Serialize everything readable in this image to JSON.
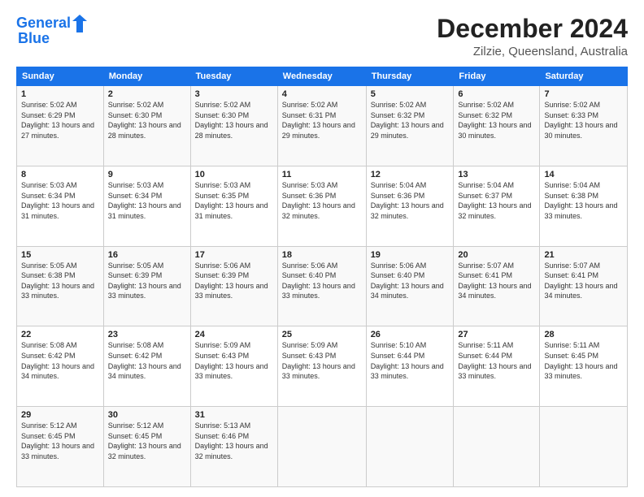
{
  "header": {
    "logo_line1": "General",
    "logo_line2": "Blue",
    "month_title": "December 2024",
    "subtitle": "Zilzie, Queensland, Australia"
  },
  "weekdays": [
    "Sunday",
    "Monday",
    "Tuesday",
    "Wednesday",
    "Thursday",
    "Friday",
    "Saturday"
  ],
  "weeks": [
    [
      {
        "day": "1",
        "sunrise": "5:02 AM",
        "sunset": "6:29 PM",
        "daylight": "13 hours and 27 minutes."
      },
      {
        "day": "2",
        "sunrise": "5:02 AM",
        "sunset": "6:30 PM",
        "daylight": "13 hours and 28 minutes."
      },
      {
        "day": "3",
        "sunrise": "5:02 AM",
        "sunset": "6:30 PM",
        "daylight": "13 hours and 28 minutes."
      },
      {
        "day": "4",
        "sunrise": "5:02 AM",
        "sunset": "6:31 PM",
        "daylight": "13 hours and 29 minutes."
      },
      {
        "day": "5",
        "sunrise": "5:02 AM",
        "sunset": "6:32 PM",
        "daylight": "13 hours and 29 minutes."
      },
      {
        "day": "6",
        "sunrise": "5:02 AM",
        "sunset": "6:32 PM",
        "daylight": "13 hours and 30 minutes."
      },
      {
        "day": "7",
        "sunrise": "5:02 AM",
        "sunset": "6:33 PM",
        "daylight": "13 hours and 30 minutes."
      }
    ],
    [
      {
        "day": "8",
        "sunrise": "5:03 AM",
        "sunset": "6:34 PM",
        "daylight": "13 hours and 31 minutes."
      },
      {
        "day": "9",
        "sunrise": "5:03 AM",
        "sunset": "6:34 PM",
        "daylight": "13 hours and 31 minutes."
      },
      {
        "day": "10",
        "sunrise": "5:03 AM",
        "sunset": "6:35 PM",
        "daylight": "13 hours and 31 minutes."
      },
      {
        "day": "11",
        "sunrise": "5:03 AM",
        "sunset": "6:36 PM",
        "daylight": "13 hours and 32 minutes."
      },
      {
        "day": "12",
        "sunrise": "5:04 AM",
        "sunset": "6:36 PM",
        "daylight": "13 hours and 32 minutes."
      },
      {
        "day": "13",
        "sunrise": "5:04 AM",
        "sunset": "6:37 PM",
        "daylight": "13 hours and 32 minutes."
      },
      {
        "day": "14",
        "sunrise": "5:04 AM",
        "sunset": "6:38 PM",
        "daylight": "13 hours and 33 minutes."
      }
    ],
    [
      {
        "day": "15",
        "sunrise": "5:05 AM",
        "sunset": "6:38 PM",
        "daylight": "13 hours and 33 minutes."
      },
      {
        "day": "16",
        "sunrise": "5:05 AM",
        "sunset": "6:39 PM",
        "daylight": "13 hours and 33 minutes."
      },
      {
        "day": "17",
        "sunrise": "5:06 AM",
        "sunset": "6:39 PM",
        "daylight": "13 hours and 33 minutes."
      },
      {
        "day": "18",
        "sunrise": "5:06 AM",
        "sunset": "6:40 PM",
        "daylight": "13 hours and 33 minutes."
      },
      {
        "day": "19",
        "sunrise": "5:06 AM",
        "sunset": "6:40 PM",
        "daylight": "13 hours and 34 minutes."
      },
      {
        "day": "20",
        "sunrise": "5:07 AM",
        "sunset": "6:41 PM",
        "daylight": "13 hours and 34 minutes."
      },
      {
        "day": "21",
        "sunrise": "5:07 AM",
        "sunset": "6:41 PM",
        "daylight": "13 hours and 34 minutes."
      }
    ],
    [
      {
        "day": "22",
        "sunrise": "5:08 AM",
        "sunset": "6:42 PM",
        "daylight": "13 hours and 34 minutes."
      },
      {
        "day": "23",
        "sunrise": "5:08 AM",
        "sunset": "6:42 PM",
        "daylight": "13 hours and 34 minutes."
      },
      {
        "day": "24",
        "sunrise": "5:09 AM",
        "sunset": "6:43 PM",
        "daylight": "13 hours and 33 minutes."
      },
      {
        "day": "25",
        "sunrise": "5:09 AM",
        "sunset": "6:43 PM",
        "daylight": "13 hours and 33 minutes."
      },
      {
        "day": "26",
        "sunrise": "5:10 AM",
        "sunset": "6:44 PM",
        "daylight": "13 hours and 33 minutes."
      },
      {
        "day": "27",
        "sunrise": "5:11 AM",
        "sunset": "6:44 PM",
        "daylight": "13 hours and 33 minutes."
      },
      {
        "day": "28",
        "sunrise": "5:11 AM",
        "sunset": "6:45 PM",
        "daylight": "13 hours and 33 minutes."
      }
    ],
    [
      {
        "day": "29",
        "sunrise": "5:12 AM",
        "sunset": "6:45 PM",
        "daylight": "13 hours and 33 minutes."
      },
      {
        "day": "30",
        "sunrise": "5:12 AM",
        "sunset": "6:45 PM",
        "daylight": "13 hours and 32 minutes."
      },
      {
        "day": "31",
        "sunrise": "5:13 AM",
        "sunset": "6:46 PM",
        "daylight": "13 hours and 32 minutes."
      },
      null,
      null,
      null,
      null
    ]
  ]
}
